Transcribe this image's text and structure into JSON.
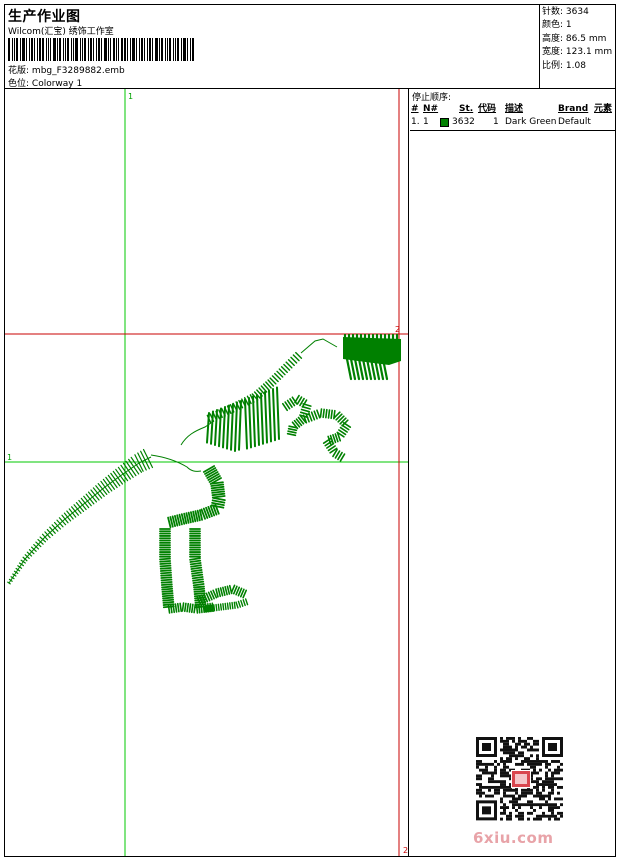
{
  "header": {
    "title": "生产作业图",
    "subtitle": "Wilcom(汇宝) 绣饰工作室",
    "pattern_label": "花版:",
    "pattern_value": "mbg_F3289882.emb",
    "colorway_label": "色位:",
    "colorway_value": "Colorway 1"
  },
  "stats": [
    {
      "label": "针数:",
      "value": "3634"
    },
    {
      "label": "颜色:",
      "value": "1"
    },
    {
      "label": "高度:",
      "value": "86.5 mm"
    },
    {
      "label": "宽度:",
      "value": "123.1 mm"
    },
    {
      "label": "比例:",
      "value": "1.08"
    }
  ],
  "canvas": {
    "marker_top": "1",
    "marker_left": "1",
    "marker_right_mid": "2",
    "marker_right_bottom": "2"
  },
  "panel": {
    "stop_sequence_label": "停止顺序:",
    "columns": [
      "#",
      "N#",
      "St.",
      "代码",
      "描述",
      "Brand",
      "元素"
    ],
    "rows": [
      {
        "num": "1.",
        "n": "1",
        "stitches": "3632",
        "code": "1",
        "description": "Dark Green",
        "brand": "Default",
        "color": "#008000"
      }
    ]
  },
  "watermark": {
    "site": "6xiu.com"
  },
  "colors": {
    "thread": "#008000",
    "guide_green": "#00c800",
    "guide_red": "#c80000"
  }
}
